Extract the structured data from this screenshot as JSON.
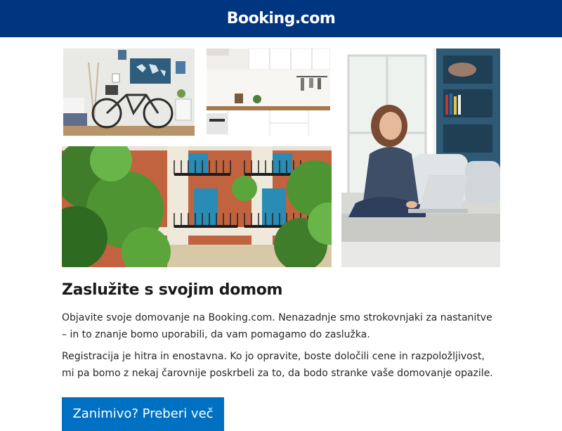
{
  "header": {
    "logo_text": "Booking.com",
    "background_color": "#003580"
  },
  "photos": [
    {
      "subject": "apartment room with bicycle and world map"
    },
    {
      "subject": "white kitchen with wooden countertop"
    },
    {
      "subject": "woman on sofa using laptop"
    },
    {
      "subject": "brick building facade with balconies and trees"
    }
  ],
  "content": {
    "title": "Zaslužite s svojim domom",
    "paragraph1": "Objavite svoje domovanje na Booking.com. Nenazadnje smo strokovnjaki za nastanitve – in to znanje bomo uporabili, da vam pomagamo do zaslužka.",
    "paragraph2": "Registracija je hitra in enostavna. Ko jo opravite, boste določili cene in razpoložljivost, mi pa bomo z nekaj čarovnije poskrbeli za to, da bodo stranke vaše domovanje opazile."
  },
  "cta": {
    "label": "Zanimivo? Preberi več",
    "color": "#0071c2"
  }
}
